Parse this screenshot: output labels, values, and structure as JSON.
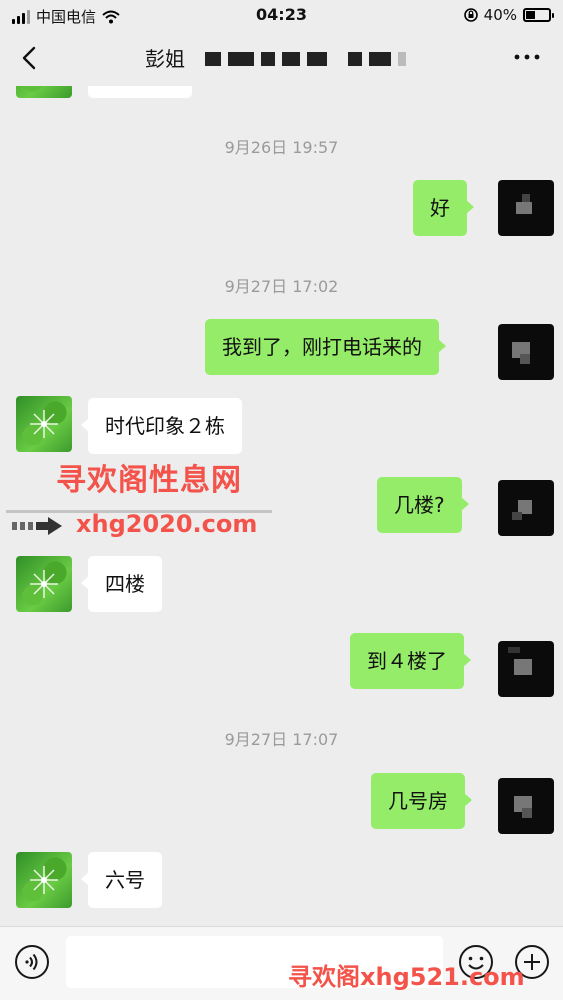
{
  "status_bar": {
    "carrier": "中国电信",
    "time": "04:23",
    "battery": "40%",
    "battery_level": 0.4
  },
  "nav": {
    "title": "彭姐",
    "back_icon": "chevron-left-icon",
    "more_icon": "more-dots-icon"
  },
  "messages": [
    {
      "type": "time",
      "text": "9月26日 19:57"
    },
    {
      "type": "msg",
      "side": "right",
      "text": "好"
    },
    {
      "type": "time",
      "text": "9月27日 17:02"
    },
    {
      "type": "msg",
      "side": "right",
      "text": "我到了，刚打电话来的"
    },
    {
      "type": "msg",
      "side": "left",
      "text": "时代印象２栋"
    },
    {
      "type": "msg",
      "side": "right",
      "text": "几楼?"
    },
    {
      "type": "msg",
      "side": "left",
      "text": "四楼"
    },
    {
      "type": "msg",
      "side": "right",
      "text": "到４楼了"
    },
    {
      "type": "time",
      "text": "9月27日 17:07"
    },
    {
      "type": "msg",
      "side": "right",
      "text": "几号房"
    },
    {
      "type": "msg",
      "side": "left",
      "text": "六号"
    }
  ],
  "watermark": {
    "title": "寻欢阁性息网",
    "url": "xhg2020.com",
    "bottom": "寻欢阁xhg521.com"
  },
  "input": {
    "value": "",
    "voice_icon": "voice-icon",
    "emoji_icon": "emoji-icon",
    "plus_icon": "plus-icon"
  },
  "colors": {
    "background": "#ededed",
    "bubble_right": "#95ec69",
    "bubble_left": "#ffffff",
    "watermark": "#f3534a"
  }
}
